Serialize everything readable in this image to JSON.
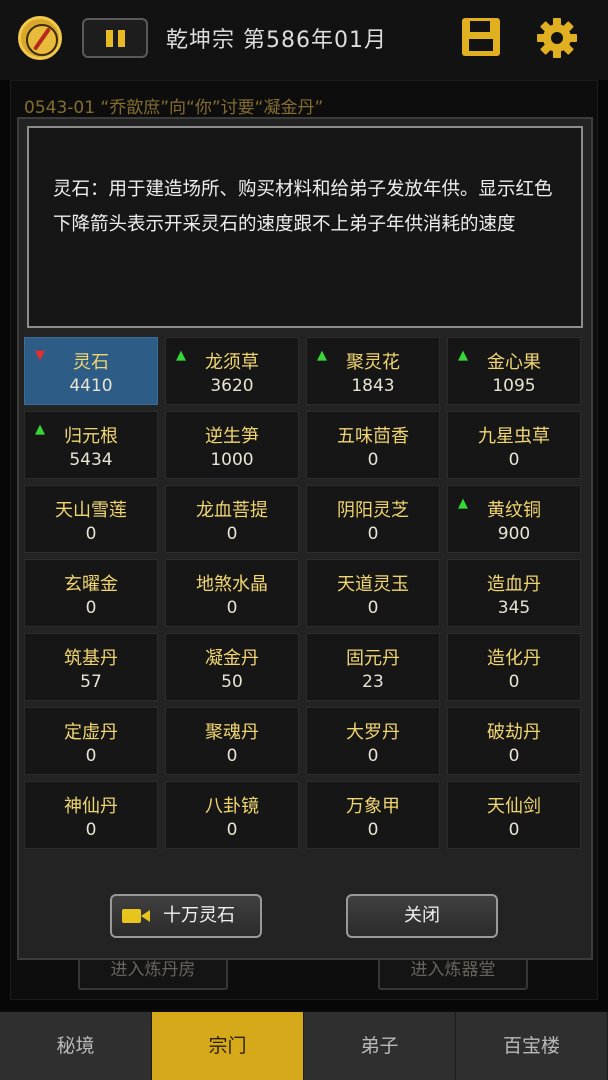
{
  "header": {
    "title": "乾坤宗 第586年01月"
  },
  "background": {
    "notice": "0543-01 “乔歆庶”向“你”讨要“凝金丹”",
    "button_left": "进入炼丹房",
    "button_right": "进入炼器堂"
  },
  "modal": {
    "description": "灵石：用于建造场所、购买材料和给弟子发放年供。显示红色下降箭头表示开采灵石的速度跟不上弟子年供消耗的速度",
    "items": [
      {
        "name": "灵石",
        "value": "4410",
        "trend": "down"
      },
      {
        "name": "龙须草",
        "value": "3620",
        "trend": "up"
      },
      {
        "name": "聚灵花",
        "value": "1843",
        "trend": "up"
      },
      {
        "name": "金心果",
        "value": "1095",
        "trend": "up"
      },
      {
        "name": "归元根",
        "value": "5434",
        "trend": "up"
      },
      {
        "name": "逆生笋",
        "value": "1000",
        "trend": ""
      },
      {
        "name": "五味茴香",
        "value": "0",
        "trend": ""
      },
      {
        "name": "九星虫草",
        "value": "0",
        "trend": ""
      },
      {
        "name": "天山雪莲",
        "value": "0",
        "trend": ""
      },
      {
        "name": "龙血菩提",
        "value": "0",
        "trend": ""
      },
      {
        "name": "阴阳灵芝",
        "value": "0",
        "trend": ""
      },
      {
        "name": "黄纹铜",
        "value": "900",
        "trend": "up"
      },
      {
        "name": "玄曜金",
        "value": "0",
        "trend": ""
      },
      {
        "name": "地煞水晶",
        "value": "0",
        "trend": ""
      },
      {
        "name": "天道灵玉",
        "value": "0",
        "trend": ""
      },
      {
        "name": "造血丹",
        "value": "345",
        "trend": ""
      },
      {
        "name": "筑基丹",
        "value": "57",
        "trend": ""
      },
      {
        "name": "凝金丹",
        "value": "50",
        "trend": ""
      },
      {
        "name": "固元丹",
        "value": "23",
        "trend": ""
      },
      {
        "name": "造化丹",
        "value": "0",
        "trend": ""
      },
      {
        "name": "定虚丹",
        "value": "0",
        "trend": ""
      },
      {
        "name": "聚魂丹",
        "value": "0",
        "trend": ""
      },
      {
        "name": "大罗丹",
        "value": "0",
        "trend": ""
      },
      {
        "name": "破劫丹",
        "value": "0",
        "trend": ""
      },
      {
        "name": "神仙丹",
        "value": "0",
        "trend": ""
      },
      {
        "name": "八卦镜",
        "value": "0",
        "trend": ""
      },
      {
        "name": "万象甲",
        "value": "0",
        "trend": ""
      },
      {
        "name": "天仙剑",
        "value": "0",
        "trend": ""
      }
    ],
    "ad_button": "十万灵石",
    "close_button": "关闭"
  },
  "tabs": [
    {
      "label": "秘境",
      "active": false
    },
    {
      "label": "宗门",
      "active": true
    },
    {
      "label": "弟子",
      "active": false
    },
    {
      "label": "百宝楼",
      "active": false
    }
  ],
  "colors": {
    "accent": "#d6a91b",
    "selected_cell": "#2d5c86",
    "trend_up": "#36d636",
    "trend_down": "#e02f2f"
  }
}
